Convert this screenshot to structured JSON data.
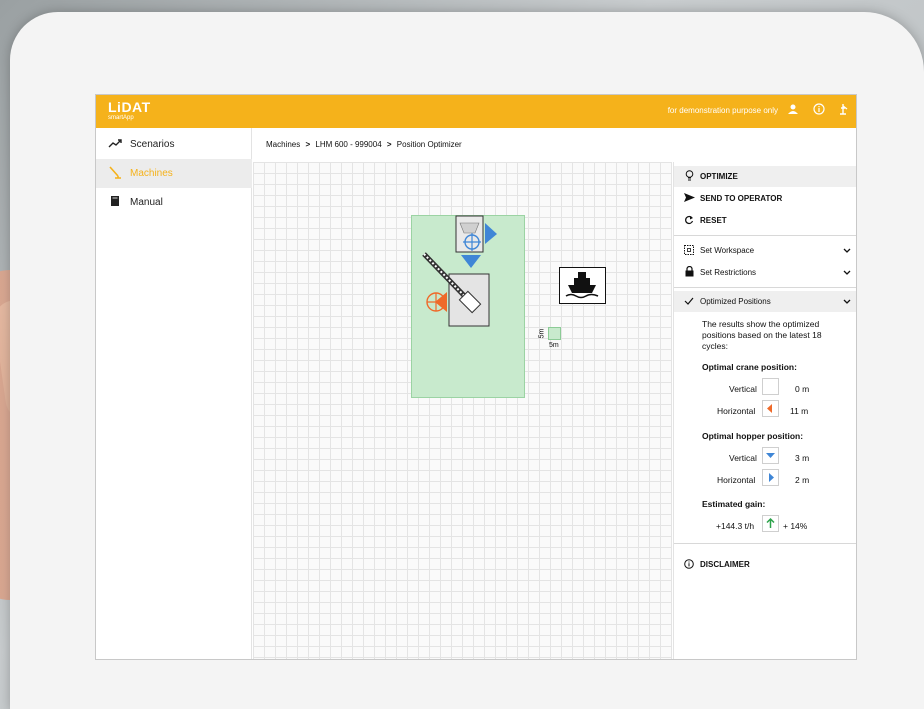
{
  "app": {
    "logo": "LiDAT",
    "logo_sub": "smartApp",
    "demo_note": "for demonstration purpose only"
  },
  "sidebar": {
    "items": [
      {
        "label": "Scenarios",
        "icon": "trend-icon"
      },
      {
        "label": "Machines",
        "icon": "crane-icon",
        "active": true
      },
      {
        "label": "Manual",
        "icon": "book-icon"
      }
    ]
  },
  "breadcrumb": {
    "parts": [
      "Machines",
      "LHM 600 - 999004",
      "Position Optimizer"
    ],
    "separator": ">"
  },
  "panel": {
    "actions": [
      {
        "label": "OPTIMIZE",
        "icon": "lightbulb-icon"
      },
      {
        "label": "SEND TO OPERATOR",
        "icon": "send-icon"
      },
      {
        "label": "RESET",
        "icon": "reset-icon"
      }
    ],
    "sections": [
      {
        "label": "Set Workspace",
        "icon": "workspace-icon"
      },
      {
        "label": "Set Restrictions",
        "icon": "lock-icon"
      },
      {
        "label": "Optimized Positions",
        "icon": "check-icon"
      }
    ],
    "optimized": {
      "intro": "The results show the optimized positions based on the latest 18 cycles:",
      "crane_title": "Optimal crane position:",
      "crane_vertical_label": "Vertical",
      "crane_vertical_value": "0 m",
      "crane_horizontal_label": "Horizontal",
      "crane_horizontal_value": "11 m",
      "hopper_title": "Optimal hopper position:",
      "hopper_vertical_label": "Vertical",
      "hopper_vertical_value": "3 m",
      "hopper_horizontal_label": "Horizontal",
      "hopper_horizontal_value": "2 m",
      "gain_title": "Estimated gain:",
      "gain_value": "+144.3 t/h",
      "gain_percent": "+ 14%"
    },
    "disclaimer": "DISCLAIMER"
  },
  "canvas": {
    "scale_label_v": "5m",
    "scale_label_h": "5m"
  },
  "colors": {
    "brand": "#f5b21b",
    "workspace": "#c8eacd",
    "hopper_marker": "#3f86d6",
    "crane_marker": "#ef6a2a",
    "gain_up": "#2ca24a"
  }
}
